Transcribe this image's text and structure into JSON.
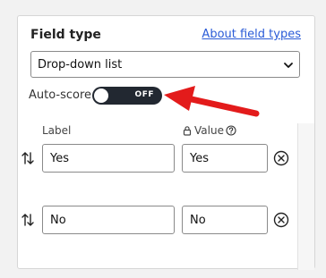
{
  "field_type": {
    "label": "Field type",
    "about_link": "About field types",
    "selected": "Drop-down list"
  },
  "auto_score": {
    "label": "Auto-score",
    "state": "OFF"
  },
  "columns": {
    "label": "Label",
    "value": "Value"
  },
  "rows": [
    {
      "label": "Yes",
      "value": "Yes"
    },
    {
      "label": "No",
      "value": "No"
    }
  ],
  "colors": {
    "link": "#2a5bd7",
    "toggle_off": "#222831",
    "annotation_arrow": "#e31b1b"
  },
  "icons": {
    "select": "chevron-down-icon",
    "value_column": [
      "lock-icon",
      "help-icon"
    ],
    "row_handle": "sort-arrows-icon",
    "row_remove": "remove-circle-icon"
  }
}
